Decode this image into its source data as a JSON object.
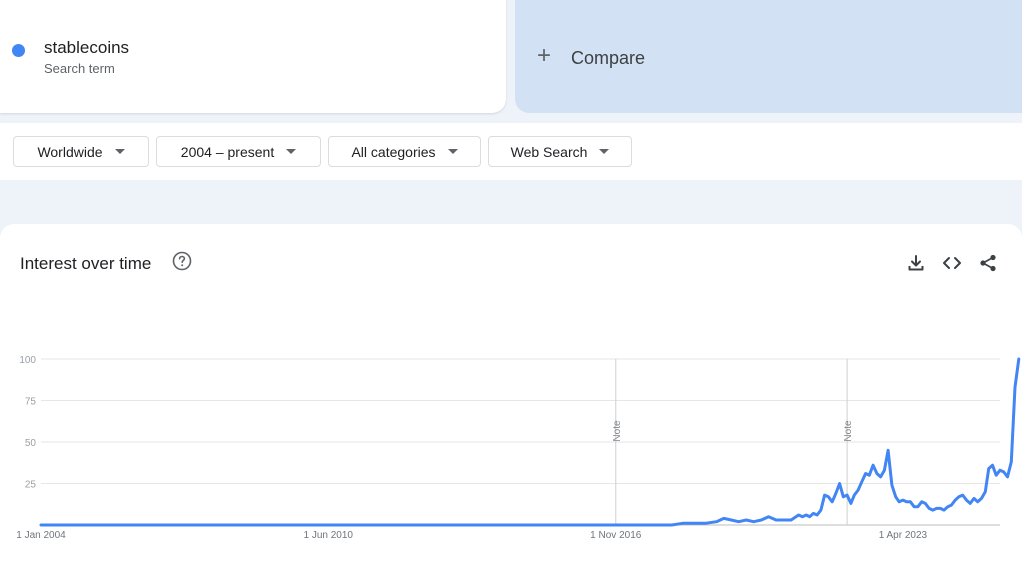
{
  "term": {
    "name": "stablecoins",
    "subtitle": "Search term",
    "color": "#4285f4"
  },
  "compare": {
    "icon": "plus-icon",
    "label": "Compare"
  },
  "filters": [
    {
      "label": "Worldwide"
    },
    {
      "label": "2004 – present"
    },
    {
      "label": "All categories"
    },
    {
      "label": "Web Search"
    }
  ],
  "panel": {
    "title": "Interest over time",
    "help_icon": "help-circle-icon",
    "actions": [
      "download-icon",
      "embed-code-icon",
      "share-icon"
    ]
  },
  "chart_data": {
    "type": "line",
    "title": "",
    "xlabel": "",
    "ylabel": "",
    "x_range": [
      "2004-01-01",
      "2025-06-01"
    ],
    "ylim": [
      0,
      100
    ],
    "yticks": [
      25,
      50,
      75,
      100
    ],
    "xtick_labels": [
      {
        "date": "2004-01-01",
        "label": "1 Jan 2004"
      },
      {
        "date": "2010-06-01",
        "label": "1 Jun 2010"
      },
      {
        "date": "2016-11-01",
        "label": "1 Nov 2016"
      },
      {
        "date": "2023-04-01",
        "label": "1 Apr 2023"
      }
    ],
    "notes": [
      {
        "date": "2016-11-01",
        "label": "Note"
      },
      {
        "date": "2022-01-01",
        "label": "Note"
      }
    ],
    "grid": true,
    "series": [
      {
        "name": "stablecoins",
        "color": "#4285f4",
        "points": [
          [
            "2004-01-01",
            0
          ],
          [
            "2018-02-01",
            0
          ],
          [
            "2018-05-01",
            1
          ],
          [
            "2018-08-01",
            1
          ],
          [
            "2018-11-01",
            1
          ],
          [
            "2019-02-01",
            2
          ],
          [
            "2019-04-01",
            4
          ],
          [
            "2019-06-01",
            3
          ],
          [
            "2019-08-01",
            2
          ],
          [
            "2019-10-01",
            3
          ],
          [
            "2019-12-01",
            2
          ],
          [
            "2020-02-01",
            3
          ],
          [
            "2020-04-01",
            5
          ],
          [
            "2020-06-01",
            3
          ],
          [
            "2020-08-01",
            3
          ],
          [
            "2020-10-01",
            3
          ],
          [
            "2020-12-01",
            6
          ],
          [
            "2021-01-01",
            5
          ],
          [
            "2021-02-01",
            6
          ],
          [
            "2021-03-01",
            5
          ],
          [
            "2021-04-01",
            7
          ],
          [
            "2021-05-01",
            6
          ],
          [
            "2021-06-01",
            9
          ],
          [
            "2021-07-01",
            18
          ],
          [
            "2021-08-01",
            17
          ],
          [
            "2021-09-01",
            14
          ],
          [
            "2021-10-01",
            19
          ],
          [
            "2021-11-01",
            25
          ],
          [
            "2021-12-01",
            17
          ],
          [
            "2022-01-01",
            18
          ],
          [
            "2022-02-01",
            13
          ],
          [
            "2022-03-01",
            18
          ],
          [
            "2022-04-01",
            21
          ],
          [
            "2022-05-01",
            26
          ],
          [
            "2022-06-01",
            31
          ],
          [
            "2022-07-01",
            30
          ],
          [
            "2022-08-01",
            36
          ],
          [
            "2022-09-01",
            31
          ],
          [
            "2022-10-01",
            29
          ],
          [
            "2022-11-01",
            33
          ],
          [
            "2022-12-01",
            45
          ],
          [
            "2023-01-01",
            24
          ],
          [
            "2023-02-01",
            17
          ],
          [
            "2023-03-01",
            14
          ],
          [
            "2023-04-01",
            15
          ],
          [
            "2023-05-01",
            14
          ],
          [
            "2023-06-01",
            14
          ],
          [
            "2023-07-01",
            11
          ],
          [
            "2023-08-01",
            11
          ],
          [
            "2023-09-01",
            14
          ],
          [
            "2023-10-01",
            13
          ],
          [
            "2023-11-01",
            10
          ],
          [
            "2023-12-01",
            9
          ],
          [
            "2024-01-01",
            10
          ],
          [
            "2024-02-01",
            10
          ],
          [
            "2024-03-01",
            9
          ],
          [
            "2024-04-01",
            11
          ],
          [
            "2024-05-01",
            12
          ],
          [
            "2024-06-01",
            15
          ],
          [
            "2024-07-01",
            17
          ],
          [
            "2024-08-01",
            18
          ],
          [
            "2024-09-01",
            15
          ],
          [
            "2024-10-01",
            13
          ],
          [
            "2024-11-01",
            16
          ],
          [
            "2024-12-01",
            14
          ],
          [
            "2025-01-01",
            16
          ],
          [
            "2025-02-01",
            20
          ],
          [
            "2025-03-01",
            34
          ],
          [
            "2025-04-01",
            36
          ],
          [
            "2025-05-01",
            30
          ],
          [
            "2025-06-01",
            33
          ],
          [
            "2025-07-01",
            32
          ],
          [
            "2025-08-01",
            29
          ],
          [
            "2025-09-01",
            38
          ],
          [
            "2025-10-01",
            83
          ],
          [
            "2025-11-01",
            100
          ]
        ]
      }
    ]
  }
}
